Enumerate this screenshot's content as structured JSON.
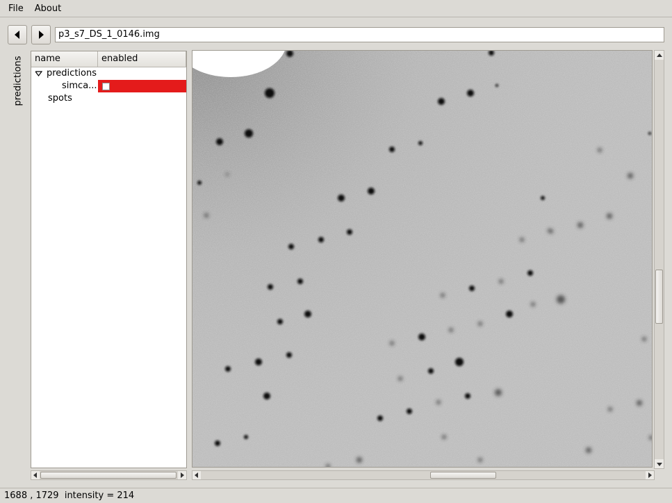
{
  "menubar": {
    "items": [
      "File",
      "About"
    ]
  },
  "toolbar": {
    "back_icon": "triangle-left-icon",
    "forward_icon": "triangle-right-icon",
    "path_value": "p3_s7_DS_1_0146.img"
  },
  "side_tab": {
    "label": "predictions"
  },
  "tree": {
    "columns": [
      "name",
      "enabled"
    ],
    "rows": {
      "predictions": "predictions",
      "simca": "simca...",
      "spots": "spots"
    },
    "simca_enabled_color": "#e41b1b"
  },
  "statusbar": {
    "text": "1688 , 1729  intensity = 214"
  }
}
